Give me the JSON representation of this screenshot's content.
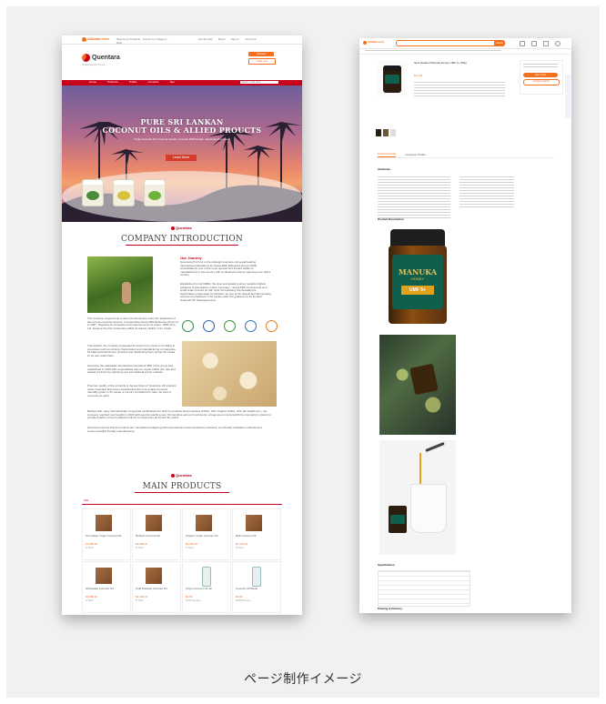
{
  "caption": "ページ制作イメージ",
  "left_screen": {
    "topbar": {
      "logo": "Alibaba.com",
      "links": [
        "Get the App",
        "Buyer",
        "Sign In",
        "Join Free"
      ]
    },
    "brand": {
      "name": "Quentara",
      "tagline": "Quentara (Pvt) Ltd.",
      "buttons": [
        "Contact",
        "Chat now"
      ]
    },
    "nav": {
      "items": [
        "Home",
        "Products",
        "Profile",
        "Contacts",
        "Tips"
      ],
      "search_placeholder": "Search in this store"
    },
    "hero": {
      "title_line1": "PURE SRI LANKAN",
      "title_line2": "COCONUT OILS & ALLIED PROUCTS",
      "subtitle": "Virgin Coconut Oil, Coconut Cream, Coconut Milk Powder, Desiccated Coconut",
      "button": "Learn More"
    },
    "company_intro": {
      "logo": "Quentara",
      "title": "COMPANY INTRODUCTION",
      "heading": "Our Journey",
      "para1": "Quentara (Pvt) Ltd. is the strategic business unit spearheading International Operations for Seeta Mills Refineries Group (SMR Consolidated)- one of the most reputed and trusted edible oil manufacturers in the country with an illustrious history spanning over half a century.",
      "para2": "Established in mid 1960s, the slow and steady journey towards highest echelons of Quentara's mother Company - Seeta Mills commenced as a small scale coconut oil mill. Over the following five decades the organization progressed to transform as one of the largest and fast growing coconut oil producers in Sri Lanka under the guidance of its founder chairman Mr. Weerapperuma.",
      "para3": "The company stepped into a new era of business under the leadership of the current executive director. Incorporating Seeta Mills Refineries (Pvt) Ltd in 1997. Targeting for innovation and improvements for future, SMR (Pvt) Ltd, became the first continuous edible oil refinery facility in Sri Lanka.",
      "para4": "Thenceforth, the company expanded its scope from coconut oil milling to processes such as refining, fractionation and manufacturing of margarine for bakery/confectionary products and distributing them across Sri Lanka by its own retail chain.",
      "para5": "Quentara, the dedicated international operations SBU of the group was established in 2019 with a specialized team to export edible oils, fats and related products by capturing new international export markets.",
      "para6": "Premium quality of the products is the key focus of Quentara. All products under Quentara brand are manufactured from top quality coconuts naturally grown in Sri Lanka; a country considered to have the best of coconuts on earth.",
      "para7": "Backed with many internationally recognized certifications for both its products and processes (FSSC, ISO, Organic USDA, JAS, EU Health etc.), the company reached new heights in 2020 with exports reaching over 30 countries across 6 continents, a huge step to accomplish the company's mission to provide healthy coconut related products to consumers all around the world.",
      "para8": "Quentara ensures that its products are manufactured aligning with international social compliance practices, eco friendly cultivation methods and environmentally friendly manufacturing."
    },
    "main_products": {
      "logo": "Quentara",
      "title": "MAIN PRODUCTS",
      "tab": "Oils",
      "items": [
        {
          "name": "Sri Lankan Virgin Coconut Oil",
          "price": "$1,980.00",
          "moq": "5 Tons"
        },
        {
          "name": "Refined Coconut Oil",
          "price": "$1,560.00",
          "moq": "5 Tons"
        },
        {
          "name": "Organic Virgin Coconut Oil",
          "price": "$2,300.00",
          "moq": "5 Tons"
        },
        {
          "name": "Bulk Coconut Oil",
          "price": "$1,420.00",
          "moq": "5 Tons"
        },
        {
          "name": "Wholesale Coconut Oil",
          "price": "$1,880.00",
          "moq": "5 Tons"
        },
        {
          "name": "Cold Pressed Coconut Oil",
          "price": "$2,100.00",
          "moq": "5 Tons"
        },
        {
          "name": "Virgin Coconut Oil Jar",
          "price": "$2.50",
          "moq": "1000 Pieces"
        },
        {
          "name": "Coconut Oil Bottle",
          "price": "$2.80",
          "moq": "1000 Pieces"
        }
      ]
    }
  },
  "right_screen": {
    "topbar": {
      "logo": "Alibaba.com",
      "search_button": "Search"
    },
    "product": {
      "title": "New Zealand Manuka Honey UMF 5+ 500g",
      "jar_label": "MANUKA",
      "jar_sub": "HONEY",
      "umf_badge": "UMF 5+",
      "price": "$12.00",
      "buttons": [
        "Start Order",
        "Contact Supplier"
      ]
    },
    "tabs": [
      "Product Details",
      "Company Profile"
    ],
    "attributes_title": "Attributes",
    "description_title": "Product Description",
    "specification_title": "Specification",
    "packing_title": "Packing & Delivery"
  },
  "colors": {
    "alibaba_orange": "#f37021",
    "store_red": "#c7001c",
    "honey": "#e3a21a"
  }
}
